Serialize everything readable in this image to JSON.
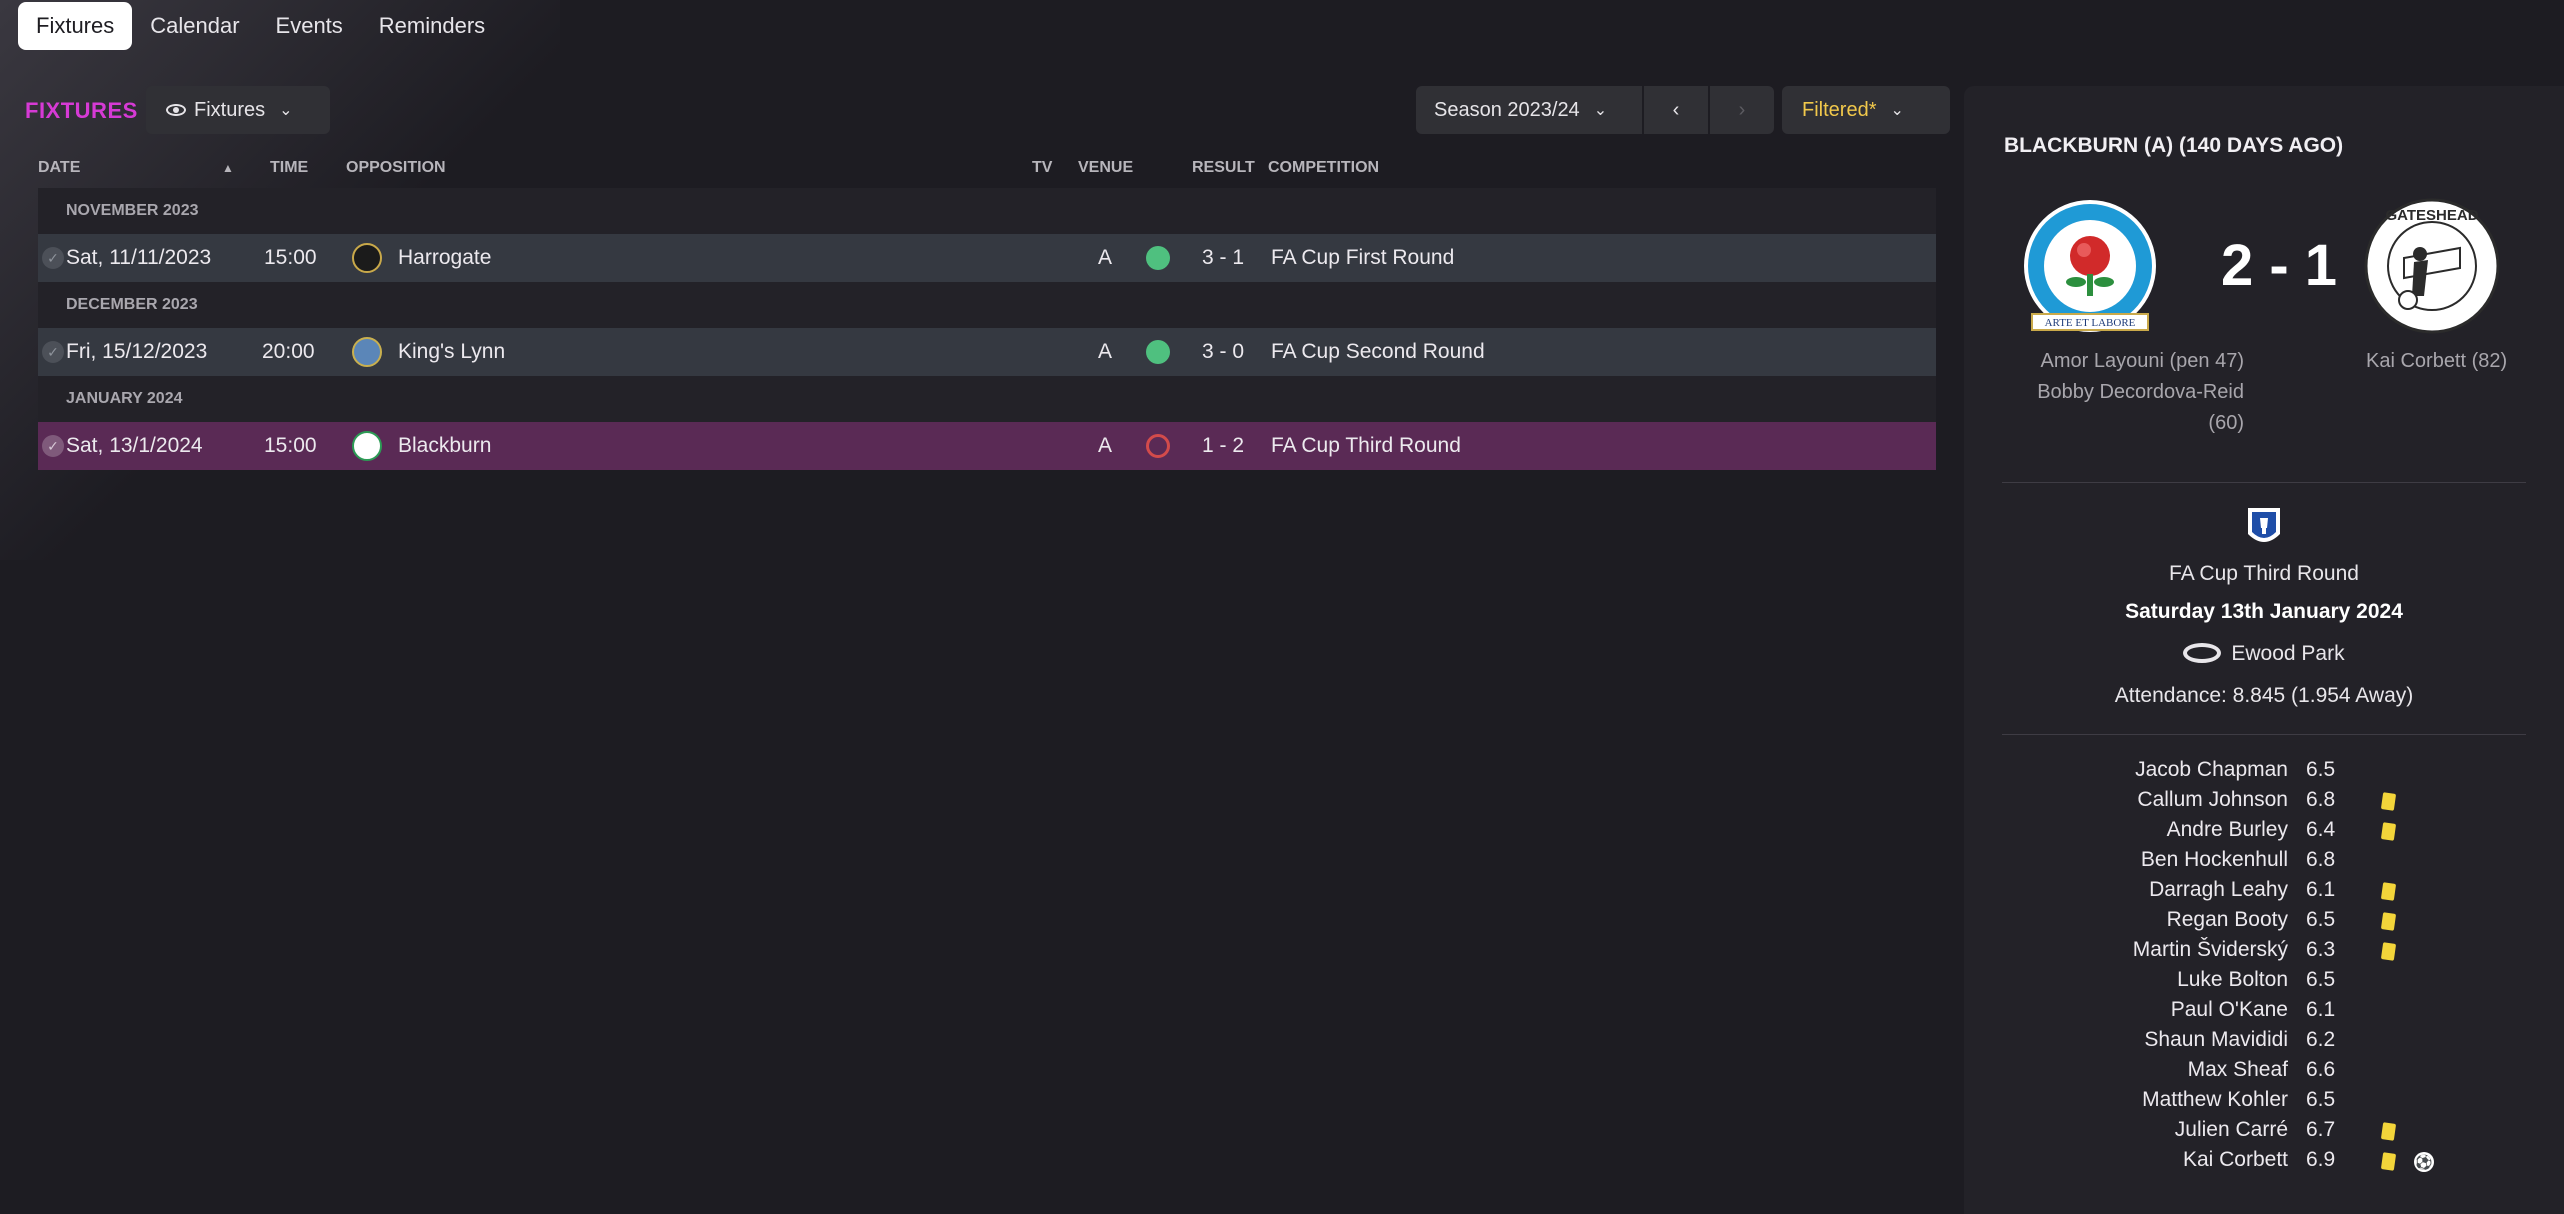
{
  "tabs": [
    {
      "label": "Fixtures",
      "active": true
    },
    {
      "label": "Calendar",
      "active": false
    },
    {
      "label": "Events",
      "active": false
    },
    {
      "label": "Reminders",
      "active": false
    }
  ],
  "toolbar": {
    "section_title": "FIXTURES",
    "view_label": "Fixtures",
    "season_label": "Season 2023/24",
    "filter_label": "Filtered*"
  },
  "table": {
    "columns": {
      "date": "DATE",
      "time": "TIME",
      "opposition": "OPPOSITION",
      "tv": "TV",
      "venue": "VENUE",
      "result": "RESULT",
      "competition": "COMPETITION"
    },
    "groups": [
      {
        "heading": "NOVEMBER 2023",
        "rows": [
          {
            "date": "Sat, 11/11/2023",
            "time": "15:00",
            "opposition": "Harrogate",
            "venue": "A",
            "outcome": "win",
            "result": "3 - 1",
            "competition": "FA Cup First Round"
          }
        ]
      },
      {
        "heading": "DECEMBER 2023",
        "rows": [
          {
            "date": "Fri, 15/12/2023",
            "time": "20:00",
            "opposition": "King's Lynn",
            "venue": "A",
            "outcome": "win",
            "result": "3 - 0",
            "competition": "FA Cup Second Round"
          }
        ]
      },
      {
        "heading": "JANUARY 2024",
        "rows": [
          {
            "date": "Sat, 13/1/2024",
            "time": "15:00",
            "opposition": "Blackburn",
            "venue": "A",
            "outcome": "loss",
            "result": "1 - 2",
            "competition": "FA Cup Third Round"
          }
        ]
      }
    ]
  },
  "match": {
    "title": "BLACKBURN (A) (140 DAYS AGO)",
    "score": "2 - 1",
    "home_crest_text": "ARTE ET LABORE",
    "away_crest_text": "GATESHEAD",
    "home_scorers": [
      "Amor Layouni (pen 47)",
      "Bobby Decordova-Reid",
      "(60)"
    ],
    "away_scorers": [
      "Kai Corbett (82)"
    ],
    "competition": "FA Cup Third Round",
    "date": "Saturday 13th January 2024",
    "stadium": "Ewood Park",
    "attendance": "Attendance: 8.845 (1.954 Away)"
  },
  "lineup": [
    {
      "name": "Jacob Chapman",
      "rating": "6.5",
      "yellow": false,
      "goal": false
    },
    {
      "name": "Callum Johnson",
      "rating": "6.8",
      "yellow": true,
      "goal": false
    },
    {
      "name": "Andre Burley",
      "rating": "6.4",
      "yellow": true,
      "goal": false
    },
    {
      "name": "Ben Hockenhull",
      "rating": "6.8",
      "yellow": false,
      "goal": false
    },
    {
      "name": "Darragh Leahy",
      "rating": "6.1",
      "yellow": true,
      "goal": false
    },
    {
      "name": "Regan Booty",
      "rating": "6.5",
      "yellow": true,
      "goal": false
    },
    {
      "name": "Martin Šviderský",
      "rating": "6.3",
      "yellow": true,
      "goal": false
    },
    {
      "name": "Luke Bolton",
      "rating": "6.5",
      "yellow": false,
      "goal": false
    },
    {
      "name": "Paul O'Kane",
      "rating": "6.1",
      "yellow": false,
      "goal": false
    },
    {
      "name": "Shaun Mavididi",
      "rating": "6.2",
      "yellow": false,
      "goal": false
    },
    {
      "name": "Max Sheaf",
      "rating": "6.6",
      "yellow": false,
      "goal": false
    },
    {
      "name": "Matthew Kohler",
      "rating": "6.5",
      "yellow": false,
      "goal": false
    },
    {
      "name": "Julien Carré",
      "rating": "6.7",
      "yellow": true,
      "goal": false
    },
    {
      "name": "Kai Corbett",
      "rating": "6.9",
      "yellow": true,
      "goal": true
    }
  ],
  "colors": {
    "accent": "#d63ad5",
    "filter": "#f1c84b",
    "win": "#4fc07f",
    "loss": "#d24b4b",
    "highlight_row": "#5a2a55"
  }
}
